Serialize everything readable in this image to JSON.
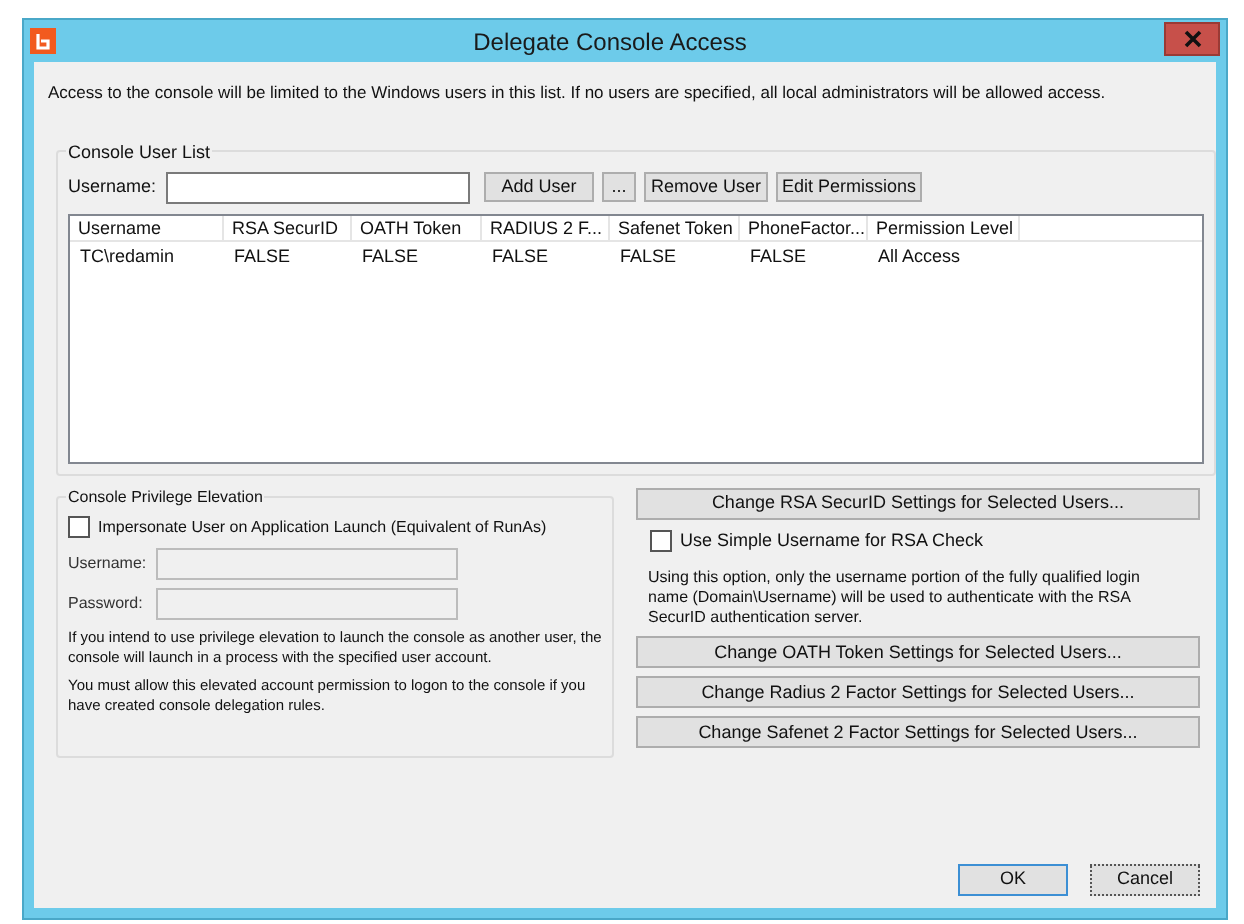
{
  "window": {
    "title": "Delegate Console Access"
  },
  "description": "Access to the console will be limited to the Windows users in this list.  If no users are specified, all local administrators will be allowed access.",
  "user_list": {
    "legend": "Console User List",
    "username_label": "Username:",
    "buttons": [
      "Add User",
      "...",
      "Remove User",
      "Edit Permissions"
    ],
    "columns": [
      "Username",
      "RSA SecurID",
      "OATH Token",
      "RADIUS 2 F...",
      "Safenet Token",
      "PhoneFactor...",
      "Permission Level"
    ],
    "rows": [
      [
        "TC\\redamin",
        "FALSE",
        "FALSE",
        "FALSE",
        "FALSE",
        "FALSE",
        "All Access"
      ]
    ]
  },
  "elevation": {
    "legend": "Console Privilege Elevation",
    "impersonate": {
      "label": "Impersonate User on Application Launch (Equivalent of RunAs)",
      "checked": false
    },
    "fields": [
      {
        "label": "Username:",
        "disabled": true
      },
      {
        "label": "Password:",
        "disabled": true
      }
    ],
    "notes": [
      "If you intend to use privilege elevation to launch the console as another user, the console will launch in a process with the specified user account.",
      "You must allow this elevated account permission to logon to the console if you have created console delegation rules."
    ]
  },
  "rsa": {
    "button": "Change RSA SecurID Settings for Selected Users...",
    "simple_username": {
      "label": "Use Simple Username for RSA Check",
      "checked": false
    },
    "note": "Using this option, only the username portion of the fully qualified login name (Domain\\Username) will be used to authenticate with the RSA SecurID authentication server."
  },
  "settings_buttons": [
    "Change OATH Token Settings for Selected Users...",
    "Change Radius 2 Factor Settings for Selected Users...",
    "Change Safenet 2 Factor Settings for Selected Users..."
  ],
  "footer_buttons": [
    {
      "label": "OK",
      "selected": true
    },
    {
      "label": "Cancel",
      "selected": false
    }
  ]
}
